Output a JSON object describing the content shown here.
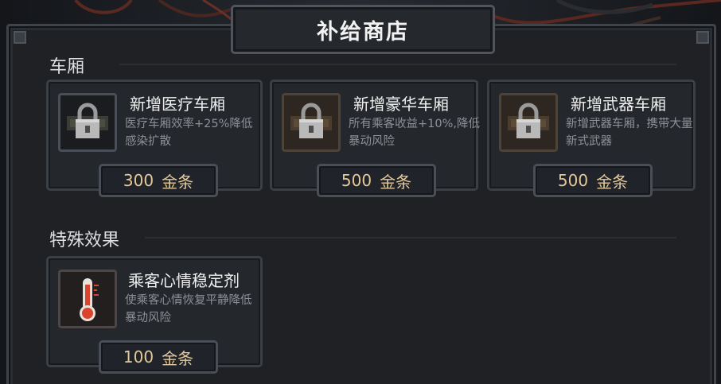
{
  "title": "补给商店",
  "sections": [
    {
      "title": "车厢"
    },
    {
      "title": "特殊效果"
    }
  ],
  "cards": [
    {
      "name": "新增医疗车厢",
      "desc": "医疗车厢效率+25%降低感染扩散",
      "price": "300",
      "currency": "金条",
      "icon": "lock-icon",
      "locked": true
    },
    {
      "name": "新增豪华车厢",
      "desc": "所有乘客收益+10%,降低暴动风险",
      "price": "500",
      "currency": "金条",
      "icon": "lock-icon",
      "locked": true
    },
    {
      "name": "新增武器车厢",
      "desc": "新增武器车厢，携带大量新式武器",
      "price": "500",
      "currency": "金条",
      "icon": "lock-icon",
      "locked": true
    },
    {
      "name": "乘客心情稳定剂",
      "desc": "使乘客心情恢复平静降低暴动风险",
      "price": "100",
      "currency": "金条",
      "icon": "thermometer-icon",
      "locked": false
    }
  ],
  "colors": {
    "price_text": "#e4c99a",
    "thermometer": "#d9452f"
  }
}
